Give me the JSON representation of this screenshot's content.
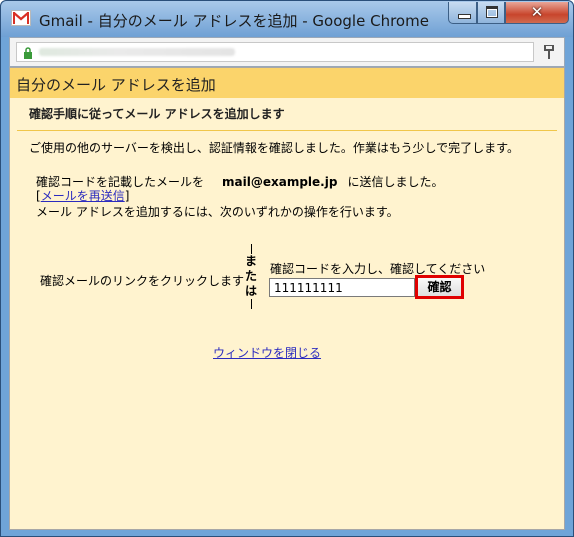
{
  "window": {
    "title": "Gmail - 自分のメール アドレスを追加 - Google Chrome",
    "close_glyph": "✕"
  },
  "page": {
    "header_title": "自分のメール アドレスを追加",
    "instructions": "確認手順に従ってメール アドレスを追加します",
    "description": "ご使用の他のサーバーを検出し、認証情報を確認しました。作業はもう少しで完了します。",
    "sent_prefix": "確認コードを記載したメールを",
    "sent_email": "mail@example.jp",
    "sent_suffix": "に送信しました。",
    "resend_open": "[",
    "resend_link": "メールを再送信",
    "resend_close": "]",
    "action_prompt": "メール アドレスを追加するには、次のいずれかの操作を行います。",
    "click_link_option": "確認メールのリンクをクリックします",
    "or_chars": [
      "ま",
      "た",
      "は"
    ],
    "code_label": "確認コードを入力し、確認してください",
    "code_value": "111111111",
    "confirm_button": "確認",
    "close_window_link": "ウィンドウを閉じる"
  },
  "colors": {
    "header_bg": "#fbd46b",
    "content_bg": "#fff3cf",
    "link": "#2b2bbf",
    "highlight_border": "#e00000"
  },
  "icons": {
    "app": "gmail-icon",
    "lock": "lock-icon",
    "menu": "wrench-icon"
  }
}
